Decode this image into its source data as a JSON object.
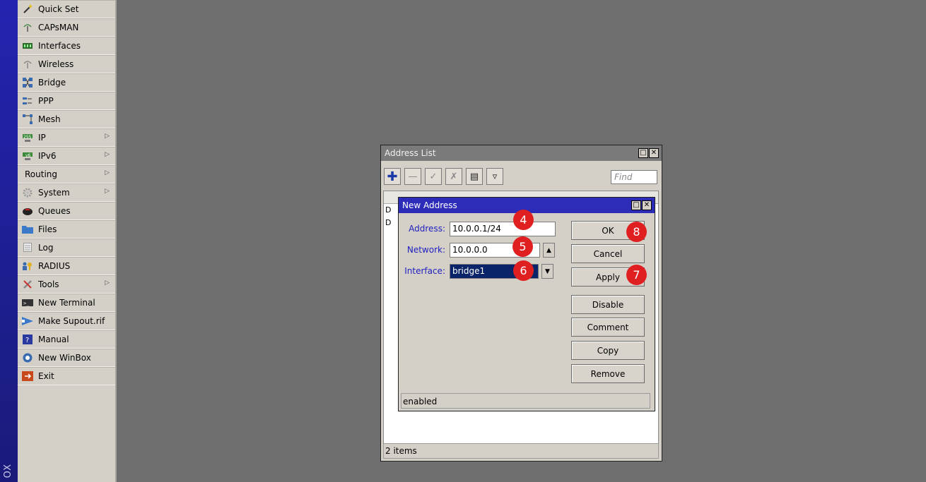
{
  "brand": {
    "text": "OX"
  },
  "menu": {
    "items": [
      {
        "label": "Quick Set",
        "icon": "wand-icon",
        "submenu": false
      },
      {
        "label": "CAPsMAN",
        "icon": "antenna-icon",
        "submenu": false
      },
      {
        "label": "Interfaces",
        "icon": "interfaces-icon",
        "submenu": false
      },
      {
        "label": "Wireless",
        "icon": "wireless-icon",
        "submenu": false
      },
      {
        "label": "Bridge",
        "icon": "bridge-icon",
        "submenu": false
      },
      {
        "label": "PPP",
        "icon": "ppp-icon",
        "submenu": false
      },
      {
        "label": "Mesh",
        "icon": "mesh-icon",
        "submenu": false
      },
      {
        "label": "IP",
        "icon": "ip-icon",
        "submenu": true
      },
      {
        "label": "IPv6",
        "icon": "ipv6-icon",
        "submenu": true
      },
      {
        "label": "Routing",
        "icon": "",
        "submenu": true
      },
      {
        "label": "System",
        "icon": "gear-icon",
        "submenu": true
      },
      {
        "label": "Queues",
        "icon": "queues-icon",
        "submenu": false
      },
      {
        "label": "Files",
        "icon": "folder-icon",
        "submenu": false
      },
      {
        "label": "Log",
        "icon": "log-icon",
        "submenu": false
      },
      {
        "label": "RADIUS",
        "icon": "radius-icon",
        "submenu": false
      },
      {
        "label": "Tools",
        "icon": "tools-icon",
        "submenu": true
      },
      {
        "label": "New Terminal",
        "icon": "terminal-icon",
        "submenu": false
      },
      {
        "label": "Make Supout.rif",
        "icon": "supout-icon",
        "submenu": false
      },
      {
        "label": "Manual",
        "icon": "manual-icon",
        "submenu": false
      },
      {
        "label": "New WinBox",
        "icon": "winbox-icon",
        "submenu": false
      },
      {
        "label": "Exit",
        "icon": "exit-icon",
        "submenu": false
      }
    ]
  },
  "address_list": {
    "title": "Address List",
    "find_placeholder": "Find",
    "rows": [
      "D",
      "D"
    ],
    "status": "2 items"
  },
  "new_address": {
    "title": "New Address",
    "address_label": "Address:",
    "address_value": "10.0.0.1/24",
    "network_label": "Network:",
    "network_value": "10.0.0.0",
    "interface_label": "Interface:",
    "interface_value": "bridge1",
    "buttons": {
      "ok": "OK",
      "cancel": "Cancel",
      "apply": "Apply",
      "disable": "Disable",
      "comment": "Comment",
      "copy": "Copy",
      "remove": "Remove"
    },
    "status": "enabled"
  },
  "annotations": [
    "4",
    "5",
    "6",
    "7",
    "8"
  ],
  "colors": {
    "desktop": "#6e6e6e",
    "active_title": "#2c2cb8",
    "inactive_title": "#7a7a7a",
    "badge": "#e02020",
    "label_blue": "#2020c0",
    "selection": "#0a246a"
  }
}
